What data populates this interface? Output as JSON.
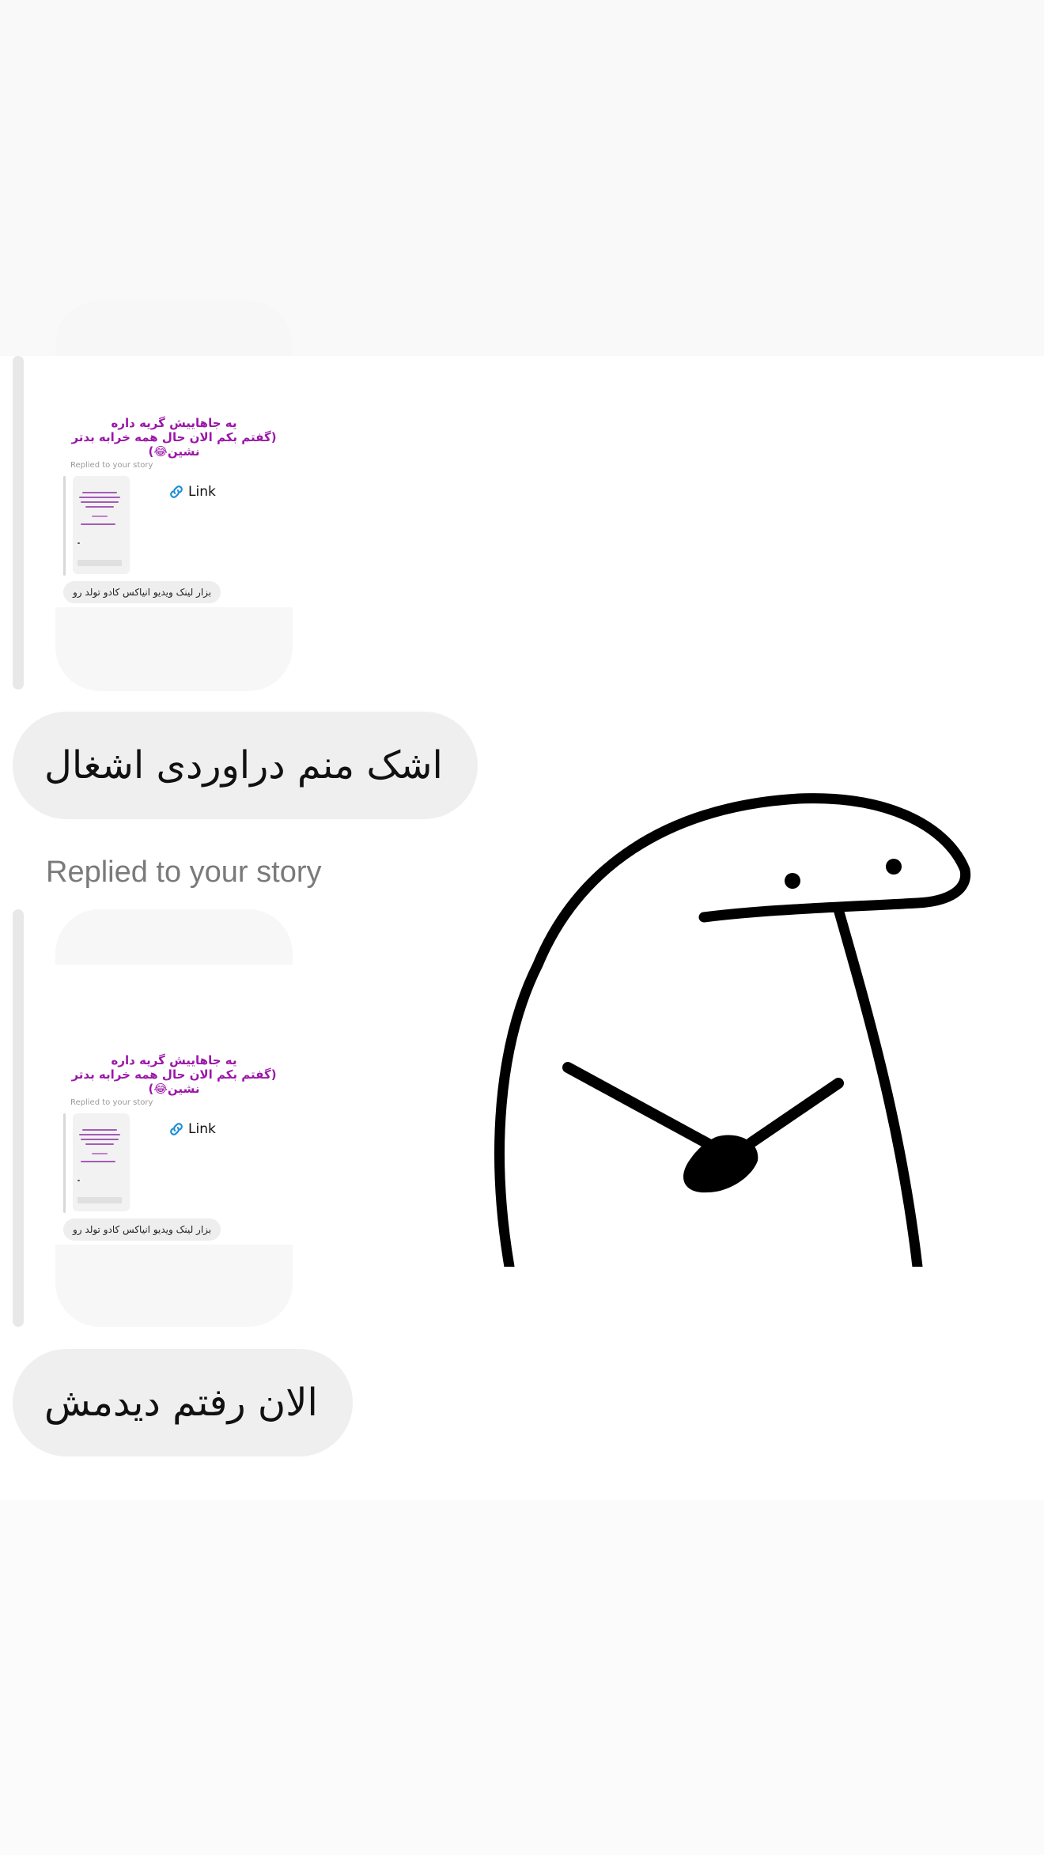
{
  "conversation": {
    "story_reply_1": {
      "caption_line1": "یه جاهاییش گریه داره",
      "caption_line2": "(گفتم بکم الان حال همه خرابه بدتر نشین😂)",
      "mini_replied_label": "Replied to your story",
      "link_label": "Link",
      "mini_message": "بزار لینک ویدیو انیاکس کادو تولد رو"
    },
    "message_1": "اشک منم دراوردی اشغال",
    "replied_label": "Replied to your story",
    "story_reply_2": {
      "caption_line1": "یه جاهاییش گریه داره",
      "caption_line2": "(گفتم بکم الان حال همه خرابه بدتر نشین😂)",
      "mini_replied_label": "Replied to your story",
      "link_label": "Link",
      "mini_message": "بزار لینک ویدیو انیاکس کادو تولد رو"
    },
    "message_2": "الان رفتم دیدمش",
    "sticker_icon": "flork-sticker-icon"
  },
  "colors": {
    "caption": "#9b17a8",
    "link_icon": "#1e8fd6",
    "bubble": "#efefef"
  }
}
